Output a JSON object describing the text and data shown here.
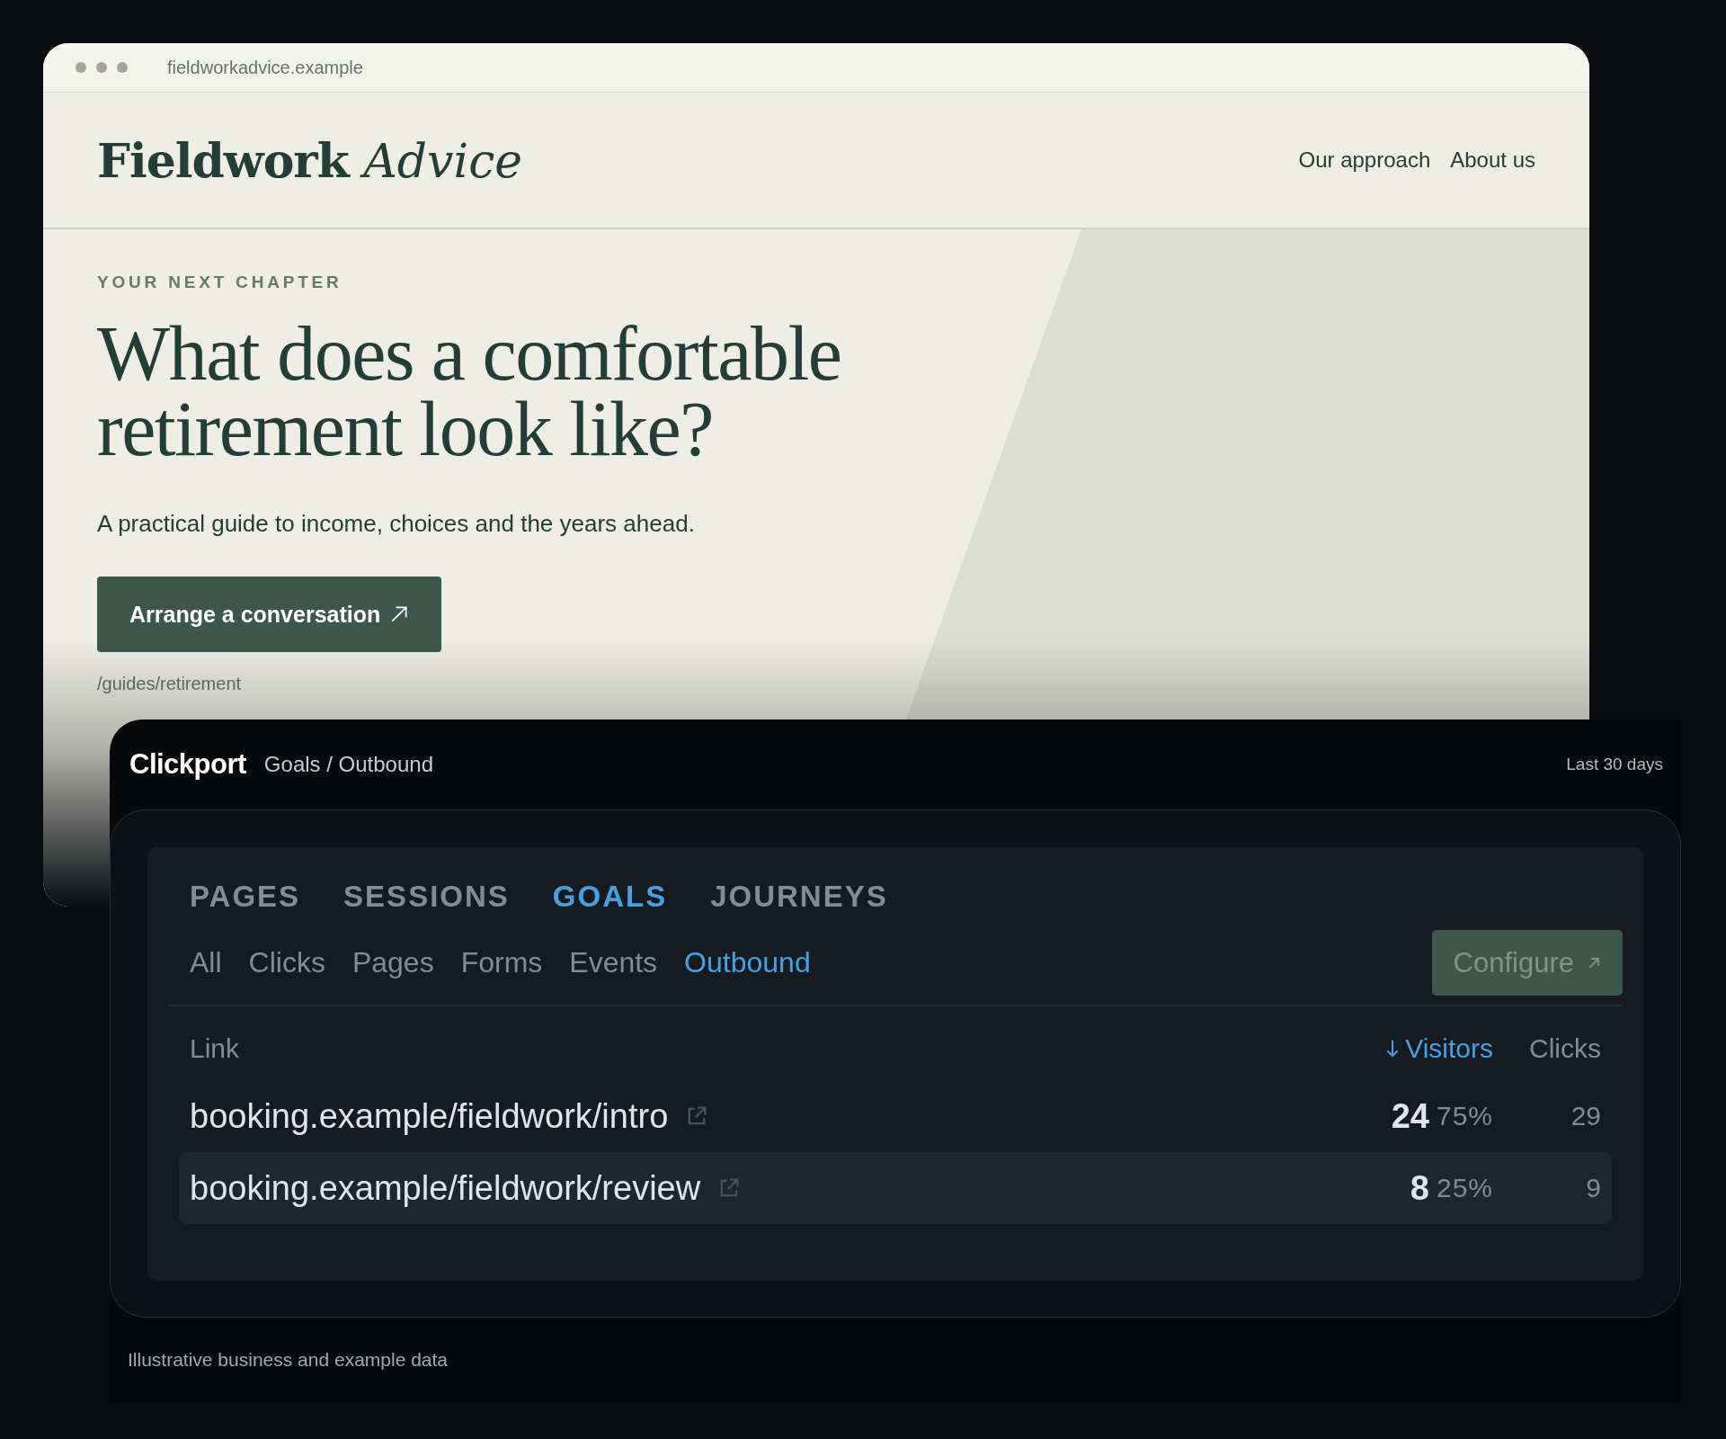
{
  "browser": {
    "url": "fieldworkadvice.example"
  },
  "site": {
    "logo": {
      "bold": "Fieldwork",
      "italic": "Advice"
    },
    "nav": [
      {
        "label": "Our approach"
      },
      {
        "label": "About us"
      }
    ]
  },
  "hero": {
    "eyebrow": "YOUR NEXT CHAPTER",
    "headline": "What does a comfortable retirement look like?",
    "subtitle": "A practical guide to income, choices and the years ahead.",
    "cta": "Arrange a conversation",
    "path": "/guides/retirement"
  },
  "dashboard": {
    "brand": "Clickport",
    "breadcrumb": "Goals / Outbound",
    "range": "Last 30 days",
    "tabs": [
      {
        "label": "PAGES",
        "selected": false
      },
      {
        "label": "SESSIONS",
        "selected": false
      },
      {
        "label": "GOALS",
        "selected": true
      },
      {
        "label": "JOURNEYS",
        "selected": false
      }
    ],
    "subtabs": [
      {
        "label": "All",
        "selected": false
      },
      {
        "label": "Clicks",
        "selected": false
      },
      {
        "label": "Pages",
        "selected": false
      },
      {
        "label": "Forms",
        "selected": false
      },
      {
        "label": "Events",
        "selected": false
      },
      {
        "label": "Outbound",
        "selected": true
      }
    ],
    "configure": "Configure",
    "columns": [
      {
        "label": "Link",
        "sorted": false
      },
      {
        "label": "Visitors",
        "sorted": true
      },
      {
        "label": "Clicks",
        "sorted": false
      }
    ],
    "rows": [
      {
        "link": "booking.example/fieldwork/intro",
        "visitors": "24",
        "share": "75%",
        "clicks": "29",
        "highlighted": false
      },
      {
        "link": "booking.example/fieldwork/review",
        "visitors": "8",
        "share": "25%",
        "clicks": "9",
        "highlighted": true
      }
    ]
  },
  "footnote": "Illustrative business and example data"
}
